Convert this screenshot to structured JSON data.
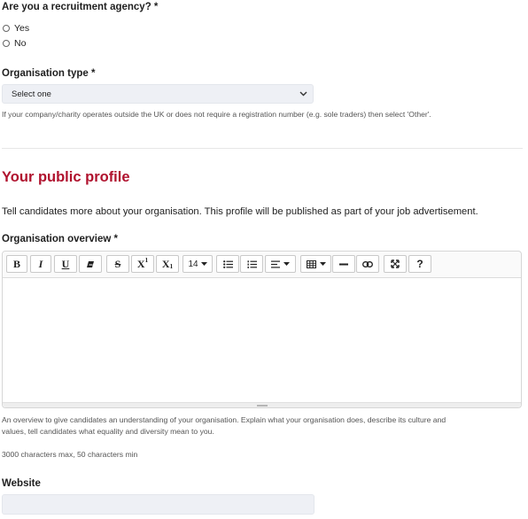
{
  "recruitment": {
    "question": "Are you a recruitment agency? *",
    "options": [
      "Yes",
      "No"
    ]
  },
  "org_type": {
    "label": "Organisation type *",
    "selected": "Select one",
    "help": "If your company/charity operates outside the UK or does not require a registration number (e.g. sole traders) then select 'Other'."
  },
  "profile": {
    "title": "Your public profile",
    "intro": "Tell candidates more about your organisation. This profile will be published as part of your job advertisement.",
    "title_color": "#b0122e"
  },
  "overview": {
    "label": "Organisation overview *",
    "toolbar": {
      "bold": "B",
      "italic": "I",
      "underline": "U",
      "strike": "S",
      "superscript": "X",
      "superscript_mark": "1",
      "subscript": "X",
      "subscript_mark": "1",
      "font_size": "14",
      "help": "?"
    },
    "help_line1": "An overview to give candidates an understanding of your organisation. Explain what your organisation does, describe its culture and",
    "help_line2": "values, tell candidates what equality and diversity mean to you.",
    "limits": "3000 characters max, 50 characters min"
  },
  "website": {
    "label": "Website",
    "value": ""
  },
  "icons": [
    "eraser-icon",
    "unordered-list-icon",
    "ordered-list-icon",
    "align-icon",
    "table-icon",
    "horizontal-rule-icon",
    "link-icon",
    "fullscreen-icon",
    "help-icon",
    "chevron-down-icon"
  ]
}
